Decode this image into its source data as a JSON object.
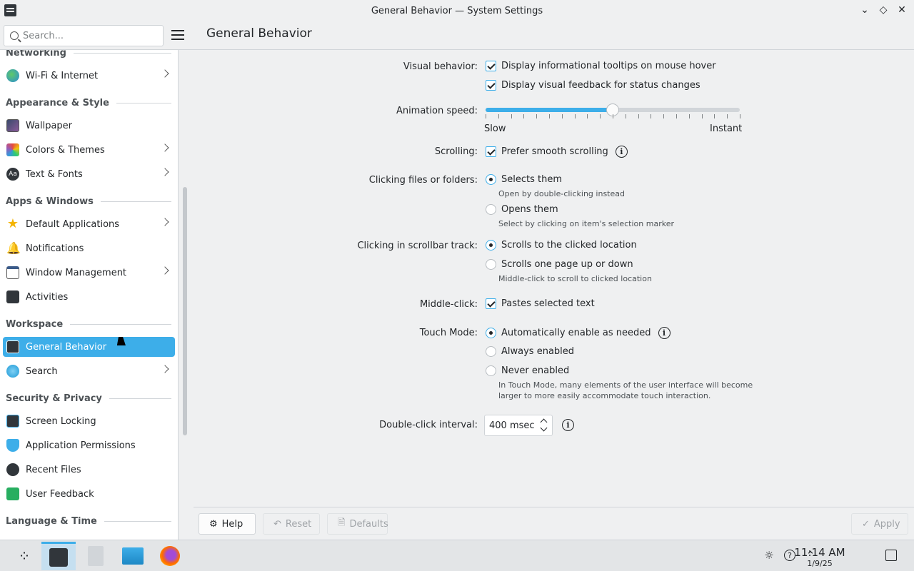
{
  "window": {
    "title": "General Behavior — System Settings"
  },
  "search": {
    "placeholder": "Search..."
  },
  "header": {
    "title": "General Behavior"
  },
  "sidebar": {
    "sections": {
      "networking": "Networking",
      "appearance": "Appearance & Style",
      "apps": "Apps & Windows",
      "workspace": "Workspace",
      "security": "Security & Privacy",
      "language": "Language & Time"
    },
    "items": {
      "wifi": "Wi-Fi & Internet",
      "wallpaper": "Wallpaper",
      "colors": "Colors & Themes",
      "text": "Text & Fonts",
      "default_apps": "Default Applications",
      "notifications": "Notifications",
      "window_mgmt": "Window Management",
      "activities": "Activities",
      "general_behavior": "General Behavior",
      "search": "Search",
      "screen_locking": "Screen Locking",
      "app_permissions": "Application Permissions",
      "recent_files": "Recent Files",
      "user_feedback": "User Feedback"
    }
  },
  "settings": {
    "visual_behavior": {
      "label": "Visual behavior:",
      "tooltips": "Display informational tooltips on mouse hover",
      "tooltips_checked": true,
      "feedback": "Display visual feedback for status changes",
      "feedback_checked": true
    },
    "animation": {
      "label": "Animation speed:",
      "slow": "Slow",
      "instant": "Instant",
      "value": 0.5
    },
    "scrolling": {
      "label": "Scrolling:",
      "smooth": "Prefer smooth scrolling",
      "checked": true
    },
    "clicking": {
      "label": "Clicking files or folders:",
      "selects": "Selects them",
      "selects_hint": "Open by double-clicking instead",
      "opens": "Opens them",
      "opens_hint": "Select by clicking on item's selection marker",
      "selected": "selects"
    },
    "scrollbar": {
      "label": "Clicking in scrollbar track:",
      "scrolls_to": "Scrolls to the clicked location",
      "scrolls_page": "Scrolls one page up or down",
      "scrolls_page_hint": "Middle-click to scroll to clicked location",
      "selected": "scrolls_to"
    },
    "middle_click": {
      "label": "Middle-click:",
      "paste": "Pastes selected text",
      "checked": true
    },
    "touch_mode": {
      "label": "Touch Mode:",
      "auto": "Automatically enable as needed",
      "always": "Always enabled",
      "never": "Never enabled",
      "hint_line1": "In Touch Mode, many elements of the user interface will become",
      "hint_line2": "larger to more easily accommodate touch interaction.",
      "selected": "auto"
    },
    "double_click": {
      "label": "Double-click interval:",
      "value": "400 msec"
    }
  },
  "actions": {
    "help": "Help",
    "reset": "Reset",
    "defaults": "Defaults",
    "apply": "Apply"
  },
  "taskbar": {
    "time": "11:14 AM",
    "date": "1/9/25"
  },
  "colors": {
    "accent": "#3daee9"
  }
}
